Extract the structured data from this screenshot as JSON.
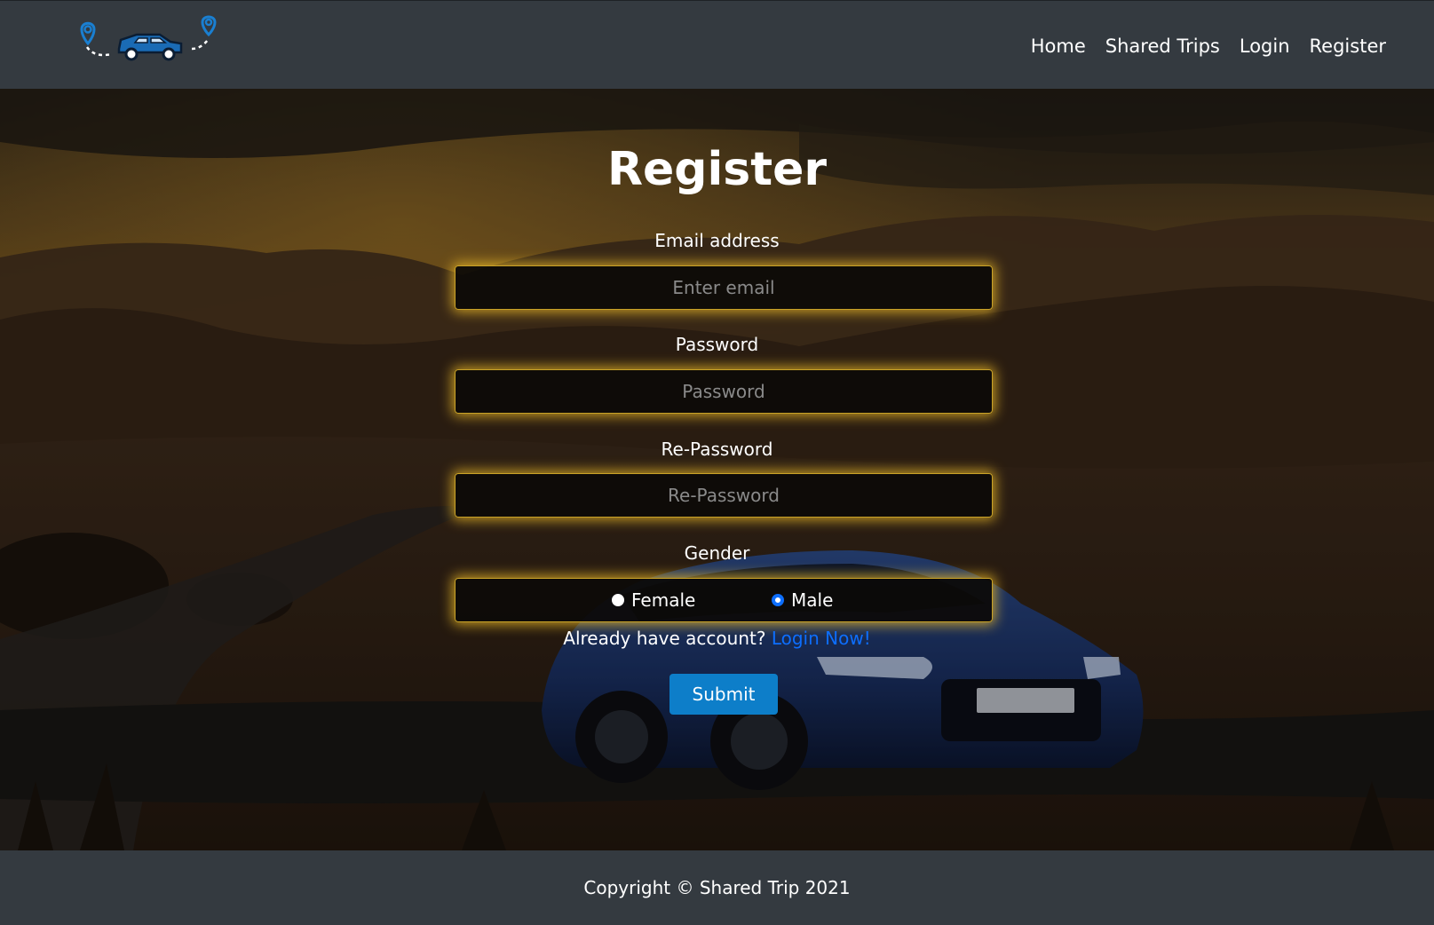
{
  "navbar": {
    "logo_icon": "route-car-logo-icon",
    "links": [
      {
        "label": "Home"
      },
      {
        "label": "Shared Trips"
      },
      {
        "label": "Login"
      },
      {
        "label": "Register"
      }
    ]
  },
  "form": {
    "title": "Register",
    "email": {
      "label": "Email address",
      "placeholder": "Enter email",
      "value": ""
    },
    "password": {
      "label": "Password",
      "placeholder": "Password",
      "value": ""
    },
    "repassword": {
      "label": "Re-Password",
      "placeholder": "Re-Password",
      "value": ""
    },
    "gender": {
      "label": "Gender",
      "options": [
        {
          "label": "Female",
          "selected": false
        },
        {
          "label": "Male",
          "selected": true
        }
      ]
    },
    "account_prompt": "Already have account?",
    "login_link": "Login Now!",
    "submit_label": "Submit"
  },
  "footer": {
    "copyright": "Copyright © Shared Trip 2021"
  },
  "colors": {
    "navbar_bg": "#343a40",
    "field_glow": "#f2be28",
    "link_blue": "#0d6efd",
    "submit_bg": "#0d7ec9",
    "logo_accent": "#1a7fd1"
  }
}
